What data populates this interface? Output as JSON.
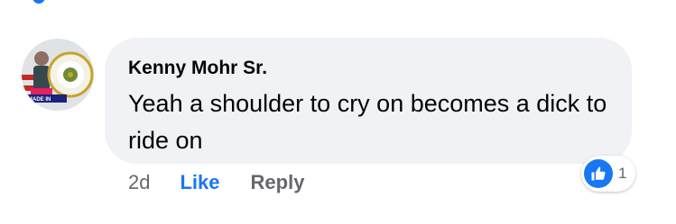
{
  "comment": {
    "author": "Kenny Mohr Sr.",
    "text": "Yeah a shoulder to cry on becomes a dick to ride on",
    "timestamp": "2d",
    "like_label": "Like",
    "reply_label": "Reply",
    "reaction_count": "1",
    "reaction_type": "like-icon",
    "avatar_badge_text": "MADE IN"
  },
  "colors": {
    "accent": "#1877f2",
    "bubble": "#f0f2f5",
    "muted_text": "#65676b",
    "text": "#050505"
  }
}
